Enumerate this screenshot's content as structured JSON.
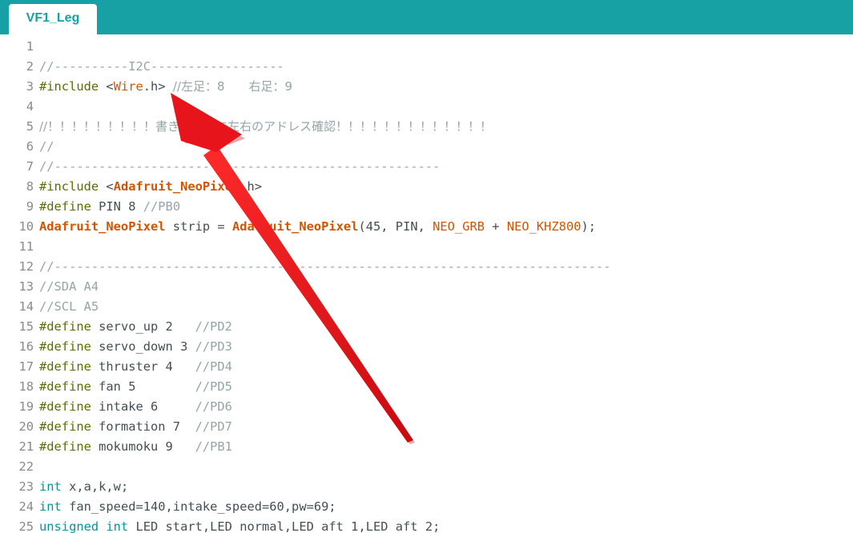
{
  "tab": {
    "label": "VF1_Leg"
  },
  "lines": [
    {
      "n": "1",
      "segs": []
    },
    {
      "n": "2",
      "segs": [
        {
          "t": "//----------I2C------------------",
          "c": "cm"
        }
      ]
    },
    {
      "n": "3",
      "segs": [
        {
          "t": "#include",
          "c": "pp"
        },
        {
          "t": " <",
          "c": "plain"
        },
        {
          "t": "Wire",
          "c": "cl"
        },
        {
          "t": ".h> ",
          "c": "plain"
        },
        {
          "t": "//左足：8　　右足：9",
          "c": "cm"
        }
      ]
    },
    {
      "n": "4",
      "segs": []
    },
    {
      "n": "5",
      "segs": [
        {
          "t": "//！！！！！！！！！書き込む前に左右のアドレス確認！！！！！！！！！！！！！",
          "c": "cm"
        }
      ]
    },
    {
      "n": "6",
      "segs": [
        {
          "t": "//",
          "c": "cm"
        }
      ]
    },
    {
      "n": "7",
      "segs": [
        {
          "t": "//----------------------------------------------------",
          "c": "cm"
        }
      ]
    },
    {
      "n": "8",
      "segs": [
        {
          "t": "#include",
          "c": "pp"
        },
        {
          "t": " <",
          "c": "plain"
        },
        {
          "t": "Adafruit_NeoPixel",
          "c": "clb"
        },
        {
          "t": ".h>",
          "c": "plain"
        }
      ]
    },
    {
      "n": "9",
      "segs": [
        {
          "t": "#define",
          "c": "pp"
        },
        {
          "t": " PIN 8 ",
          "c": "plain"
        },
        {
          "t": "//PB0",
          "c": "cm"
        }
      ]
    },
    {
      "n": "10",
      "segs": [
        {
          "t": "Adafruit_NeoPixel",
          "c": "clb"
        },
        {
          "t": " strip = ",
          "c": "plain"
        },
        {
          "t": "Adafruit_NeoPixel",
          "c": "clb"
        },
        {
          "t": "(45, PIN, ",
          "c": "plain"
        },
        {
          "t": "NEO_GRB",
          "c": "cl"
        },
        {
          "t": " + ",
          "c": "plain"
        },
        {
          "t": "NEO_KHZ800",
          "c": "cl"
        },
        {
          "t": ");",
          "c": "plain"
        }
      ]
    },
    {
      "n": "11",
      "segs": []
    },
    {
      "n": "12",
      "segs": [
        {
          "t": "//---------------------------------------------------------------------------",
          "c": "cm"
        }
      ]
    },
    {
      "n": "13",
      "segs": [
        {
          "t": "//SDA A4",
          "c": "cm"
        }
      ]
    },
    {
      "n": "14",
      "segs": [
        {
          "t": "//SCL A5",
          "c": "cm"
        }
      ]
    },
    {
      "n": "15",
      "segs": [
        {
          "t": "#define",
          "c": "pp"
        },
        {
          "t": " servo_up 2   ",
          "c": "plain"
        },
        {
          "t": "//PD2",
          "c": "cm"
        }
      ]
    },
    {
      "n": "16",
      "segs": [
        {
          "t": "#define",
          "c": "pp"
        },
        {
          "t": " servo_down 3 ",
          "c": "plain"
        },
        {
          "t": "//PD3",
          "c": "cm"
        }
      ]
    },
    {
      "n": "17",
      "segs": [
        {
          "t": "#define",
          "c": "pp"
        },
        {
          "t": " thruster 4   ",
          "c": "plain"
        },
        {
          "t": "//PD4",
          "c": "cm"
        }
      ]
    },
    {
      "n": "18",
      "segs": [
        {
          "t": "#define",
          "c": "pp"
        },
        {
          "t": " fan 5        ",
          "c": "plain"
        },
        {
          "t": "//PD5",
          "c": "cm"
        }
      ]
    },
    {
      "n": "19",
      "segs": [
        {
          "t": "#define",
          "c": "pp"
        },
        {
          "t": " intake 6     ",
          "c": "plain"
        },
        {
          "t": "//PD6",
          "c": "cm"
        }
      ]
    },
    {
      "n": "20",
      "segs": [
        {
          "t": "#define",
          "c": "pp"
        },
        {
          "t": " formation 7  ",
          "c": "plain"
        },
        {
          "t": "//PD7",
          "c": "cm"
        }
      ]
    },
    {
      "n": "21",
      "segs": [
        {
          "t": "#define",
          "c": "pp"
        },
        {
          "t": " mokumoku 9   ",
          "c": "plain"
        },
        {
          "t": "//PB1",
          "c": "cm"
        }
      ]
    },
    {
      "n": "22",
      "segs": []
    },
    {
      "n": "23",
      "segs": [
        {
          "t": "int",
          "c": "kw"
        },
        {
          "t": " x,a,k,w;",
          "c": "plain"
        }
      ]
    },
    {
      "n": "24",
      "segs": [
        {
          "t": "int",
          "c": "kw"
        },
        {
          "t": " fan_speed=140,intake_speed=60,pw=69;",
          "c": "plain"
        }
      ]
    },
    {
      "n": "25",
      "segs": [
        {
          "t": "unsigned int",
          "c": "kw"
        },
        {
          "t": " LED_start,LED_normal,LED_aft_1,LED_aft_2;",
          "c": "plain"
        }
      ]
    }
  ],
  "colors": {
    "tabbar": "#17a1a5",
    "comment": "#95a5a6",
    "preprocessor": "#5e6d03",
    "keyword": "#00979c",
    "class": "#d35400",
    "arrow": "#e8141c"
  },
  "icons": {
    "annotation": "red-arrow-icon"
  }
}
